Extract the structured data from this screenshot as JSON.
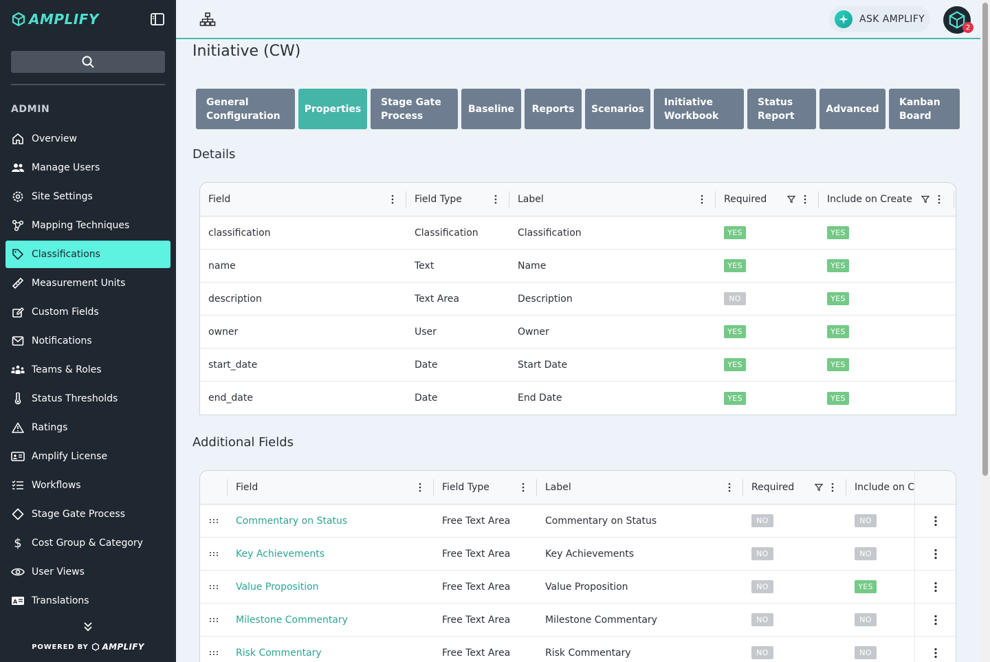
{
  "app": {
    "brand": "AMPLIFY",
    "powered_by": "POWERED BY",
    "powered_brand": "AMPLIFY"
  },
  "sidebar": {
    "section_title": "ADMIN",
    "items": [
      {
        "label": "Overview",
        "icon": "home-icon",
        "active": false
      },
      {
        "label": "Manage Users",
        "icon": "users-icon",
        "active": false
      },
      {
        "label": "Site Settings",
        "icon": "gear-icon",
        "active": false
      },
      {
        "label": "Mapping Techniques",
        "icon": "network-icon",
        "active": false
      },
      {
        "label": "Classifications",
        "icon": "tag-icon",
        "active": true
      },
      {
        "label": "Measurement Units",
        "icon": "ruler-icon",
        "active": false
      },
      {
        "label": "Custom Fields",
        "icon": "edit-field-icon",
        "active": false
      },
      {
        "label": "Notifications",
        "icon": "envelope-icon",
        "active": false
      },
      {
        "label": "Teams & Roles",
        "icon": "team-icon",
        "active": false
      },
      {
        "label": "Status Thresholds",
        "icon": "thermometer-icon",
        "active": false
      },
      {
        "label": "Ratings",
        "icon": "warning-icon",
        "active": false
      },
      {
        "label": "Amplify License",
        "icon": "id-card-icon",
        "active": false
      },
      {
        "label": "Workflows",
        "icon": "list-check-icon",
        "active": false
      },
      {
        "label": "Stage Gate Process",
        "icon": "diamond-icon",
        "active": false
      },
      {
        "label": "Cost Group & Category",
        "icon": "dollar-icon",
        "active": false
      },
      {
        "label": "User Views",
        "icon": "eye-icon",
        "active": false
      },
      {
        "label": "Translations",
        "icon": "translate-icon",
        "active": false
      }
    ]
  },
  "topbar": {
    "ask_label": "ASK AMPLIFY",
    "notification_count": "2"
  },
  "page": {
    "title": "Initiative (CW)",
    "tabs": [
      {
        "label": "General Configuration",
        "active": false
      },
      {
        "label": "Properties",
        "active": true
      },
      {
        "label": "Stage Gate Process",
        "active": false
      },
      {
        "label": "Baseline",
        "active": false
      },
      {
        "label": "Reports",
        "active": false
      },
      {
        "label": "Scenarios",
        "active": false
      },
      {
        "label": "Initiative Workbook",
        "active": false
      },
      {
        "label": "Status Report",
        "active": false
      },
      {
        "label": "Advanced",
        "active": false
      },
      {
        "label": "Kanban Board",
        "active": false
      }
    ]
  },
  "details": {
    "title": "Details",
    "columns": [
      "Field",
      "Field Type",
      "Label",
      "Required",
      "Include on Create"
    ],
    "rows": [
      {
        "field": "classification",
        "type": "Classification",
        "label": "Classification",
        "required": "YES",
        "include": "YES"
      },
      {
        "field": "name",
        "type": "Text",
        "label": "Name",
        "required": "YES",
        "include": "YES"
      },
      {
        "field": "description",
        "type": "Text Area",
        "label": "Description",
        "required": "NO",
        "include": "YES"
      },
      {
        "field": "owner",
        "type": "User",
        "label": "Owner",
        "required": "YES",
        "include": "YES"
      },
      {
        "field": "start_date",
        "type": "Date",
        "label": "Start Date",
        "required": "YES",
        "include": "YES"
      },
      {
        "field": "end_date",
        "type": "Date",
        "label": "End Date",
        "required": "YES",
        "include": "YES"
      }
    ]
  },
  "additional": {
    "title": "Additional Fields",
    "columns": [
      "Field",
      "Field Type",
      "Label",
      "Required",
      "Include on Cr"
    ],
    "rows": [
      {
        "field": "Commentary on Status",
        "type": "Free Text Area",
        "label": "Commentary on Status",
        "required": "NO",
        "include": "NO"
      },
      {
        "field": "Key Achievements",
        "type": "Free Text Area",
        "label": "Key Achievements",
        "required": "NO",
        "include": "NO"
      },
      {
        "field": "Value Proposition",
        "type": "Free Text Area",
        "label": "Value Proposition",
        "required": "NO",
        "include": "YES"
      },
      {
        "field": "Milestone Commentary",
        "type": "Free Text Area",
        "label": "Milestone Commentary",
        "required": "NO",
        "include": "NO"
      },
      {
        "field": "Risk Commentary",
        "type": "Free Text Area",
        "label": "Risk Commentary",
        "required": "NO",
        "include": "NO"
      }
    ]
  },
  "colors": {
    "sidebar_bg": "#1f2730",
    "active_nav": "#5ef2e1",
    "tab_bg": "#6e7e90",
    "tab_active": "#45b5a8",
    "yes_badge": "#74c986",
    "no_badge": "#c5c9cd",
    "link": "#2ba393"
  }
}
